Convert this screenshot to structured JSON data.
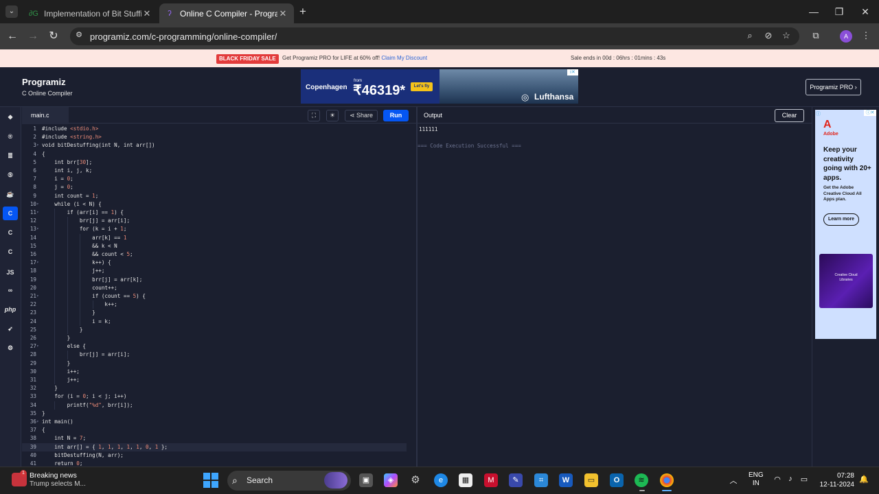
{
  "browser": {
    "tabs": [
      {
        "title": "Implementation of Bit Stuffing",
        "icon": "gfg-icon"
      },
      {
        "title": "Online C Compiler - Programiz",
        "icon": "programiz-icon"
      }
    ],
    "url": "programiz.com/c-programming/online-compiler/",
    "avatar_letter": "A"
  },
  "promo": {
    "badge": "BLACK FRIDAY SALE",
    "text": "Get Programiz PRO for LIFE at 60% off!",
    "link": "Claim My Discount",
    "timer": "Sale ends in 00d : 06hrs : 01mins : 43s"
  },
  "header": {
    "logo": "Programiz",
    "subtitle": "C Online Compiler",
    "pro_button": "Programiz PRO ›",
    "ad1": {
      "city": "Copenhagen",
      "from": "from",
      "price": "₹46319*",
      "cta": "Let's fly"
    },
    "ad2": {
      "brand": "Lufthansa"
    }
  },
  "sidebar": {
    "languages": [
      "python",
      "r",
      "sql",
      "html",
      "java",
      "c",
      "cpp",
      "csharp",
      "js",
      "go",
      "php",
      "swift",
      "rust"
    ],
    "active": "c"
  },
  "editor": {
    "filename": "main.c",
    "share_label": "Share",
    "run_label": "Run",
    "lines": [
      "#include <stdio.h>",
      "#include <string.h>",
      "void bitDestuffing(int N, int arr[])",
      "{",
      "    int brr[30];",
      "    int i, j, k;",
      "    i = 0;",
      "    j = 0;",
      "    int count = 1;",
      "    while (i < N) {",
      "        if (arr[i] == 1) {",
      "            brr[j] = arr[i];",
      "            for (k = i + 1;",
      "                arr[k] == 1",
      "                && k < N",
      "                && count < 5;",
      "                k++) {",
      "                j++;",
      "                brr[j] = arr[k];",
      "                count++;",
      "                if (count == 5) {",
      "                    k++;",
      "                }",
      "                i = k;",
      "            }",
      "        }",
      "        else {",
      "            brr[j] = arr[i];",
      "        }",
      "        i++;",
      "        j++;",
      "    }",
      "    for (i = 0; i < j; i++)",
      "        printf(\"%d\", brr[i]);",
      "}",
      "int main()",
      "{",
      "    int N = 7;",
      "    int arr[] = { 1, 1, 1, 1, 1, 0, 1 };",
      "    bitDestuffing(N, arr);",
      "    return 0;"
    ],
    "highlighted_line": 39
  },
  "output": {
    "title": "Output",
    "clear_label": "Clear",
    "result": "111111",
    "status": "=== Code Execution Successful ==="
  },
  "right_ad": {
    "brand": "Adobe",
    "headline": "Keep your creativity going with 20+ apps.",
    "sub": "Get the Adobe Creative Cloud All Apps plan.",
    "cta": "Learn more",
    "image_text": "Creative Cloud Libraries"
  },
  "taskbar": {
    "news_title": "Breaking news",
    "news_sub": "Trump selects M...",
    "news_badge": "1",
    "search_label": "Search",
    "lang": "ENG",
    "region": "IN",
    "time": "07:28",
    "date": "12-11-2024"
  }
}
